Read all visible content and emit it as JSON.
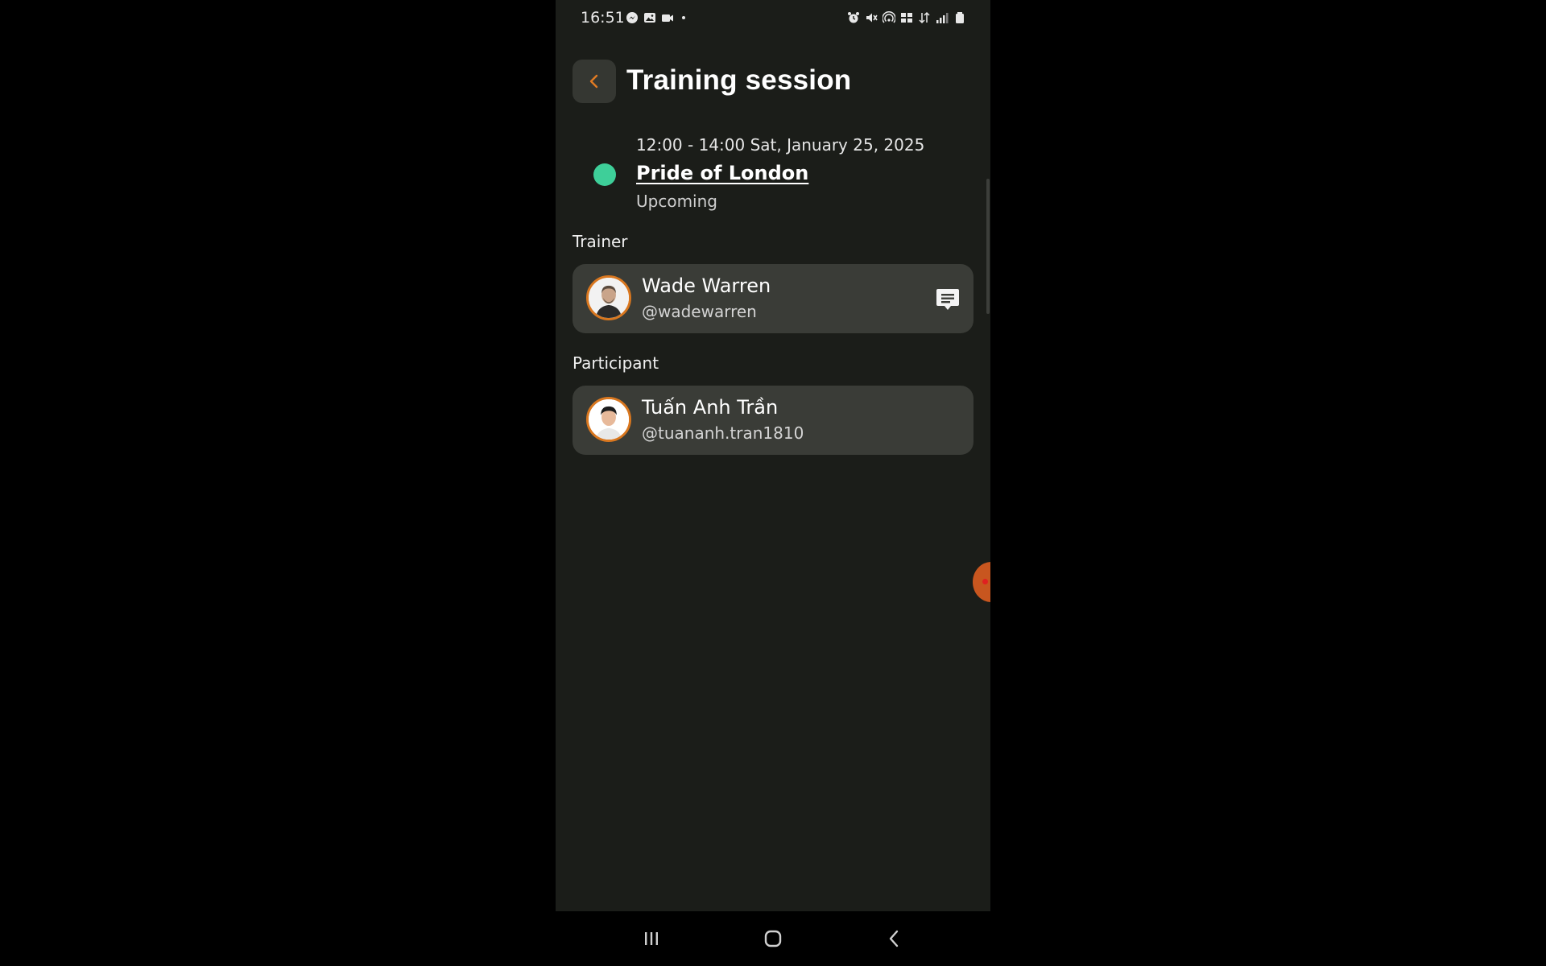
{
  "status_bar": {
    "time": "16:51",
    "left_icons": [
      "messenger-icon",
      "gallery-icon",
      "video-icon"
    ],
    "right_icons": [
      "alarm-icon",
      "mute-icon",
      "hotspot-icon",
      "volte-icon",
      "data-icon",
      "signal-icon",
      "battery-icon"
    ]
  },
  "header": {
    "back_icon": "chevron-left-icon",
    "title": "Training session"
  },
  "session": {
    "time": "12:00 - 14:00 Sat, January 25, 2025",
    "location": "Pride of London",
    "status": "Upcoming",
    "status_color": "#3ecf99"
  },
  "trainer": {
    "section_label": "Trainer",
    "name": "Wade Warren",
    "handle": "@wadewarren",
    "action_icon": "chat-icon"
  },
  "participant": {
    "section_label": "Participant",
    "name": "Tuấn Anh Trần",
    "handle": "@tuananh.tran1810"
  },
  "nav_bar": {
    "buttons": [
      "recent-apps-icon",
      "home-icon",
      "back-icon"
    ]
  },
  "colors": {
    "background": "#1b1d19",
    "card": "#3a3c37",
    "accent": "#d9771f",
    "status_green": "#3ecf99"
  }
}
